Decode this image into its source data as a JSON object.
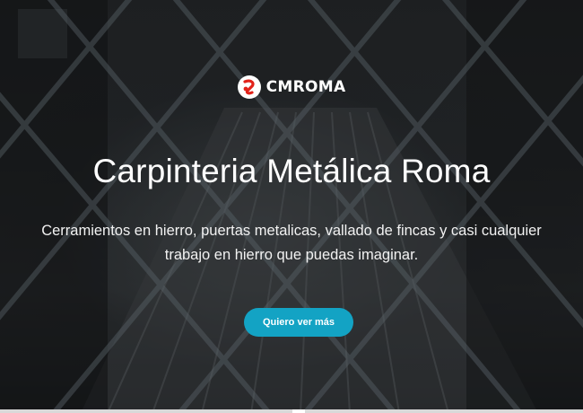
{
  "brand": {
    "name": "CMROMA",
    "logo_icon": "roma-swirl-icon",
    "logo_color": "#e2231a"
  },
  "hero": {
    "title": "Carpinteria Metálica Roma",
    "subtitle": "Cerramientos en hierro, puertas metalicas, vallado de fincas y casi cualquier trabajo en hierro que puedas imaginar.",
    "cta_label": "Quiero ver más",
    "cta_color": "#13a3c4"
  }
}
